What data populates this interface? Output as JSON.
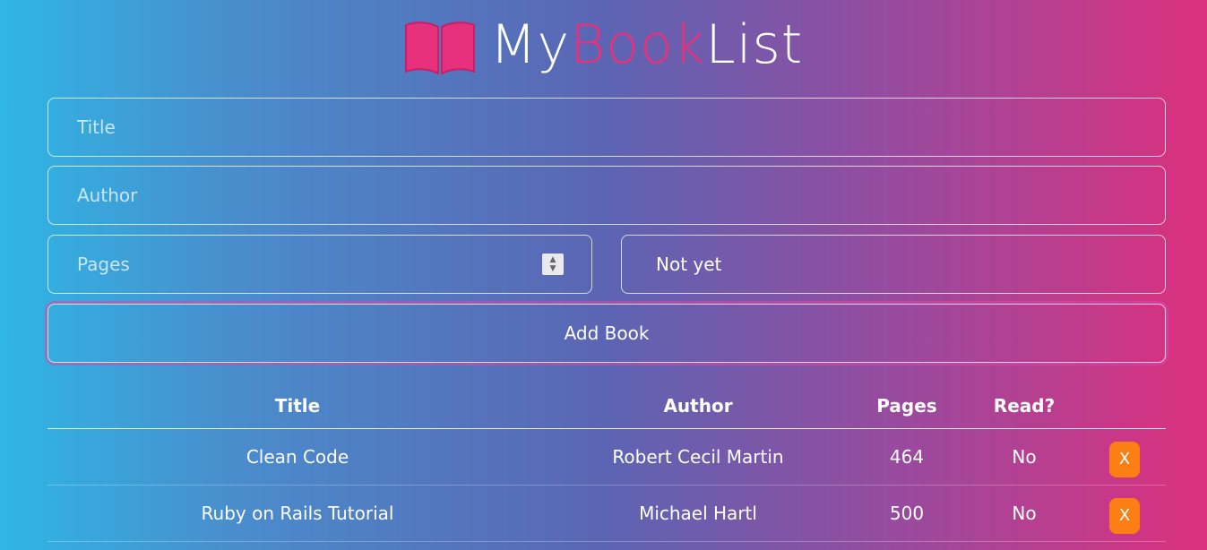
{
  "app": {
    "logo_parts": [
      "My",
      "Book",
      "List"
    ],
    "accent_color": "#e8317d",
    "delete_color": "#fb7f14"
  },
  "form": {
    "title_placeholder": "Title",
    "author_placeholder": "Author",
    "pages_placeholder": "Pages",
    "read_select_value": "Not yet",
    "add_button_label": "Add Book"
  },
  "table": {
    "headers": {
      "title": "Title",
      "author": "Author",
      "pages": "Pages",
      "read": "Read?"
    },
    "rows": [
      {
        "title": "Clean Code",
        "author": "Robert Cecil Martin",
        "pages": "464",
        "read": "No",
        "delete_label": "X"
      },
      {
        "title": "Ruby on Rails Tutorial",
        "author": "Michael Hartl",
        "pages": "500",
        "read": "No",
        "delete_label": "X"
      }
    ]
  },
  "icons": {
    "logo": "open-book-icon",
    "spinner": "number-spinner-icon"
  }
}
